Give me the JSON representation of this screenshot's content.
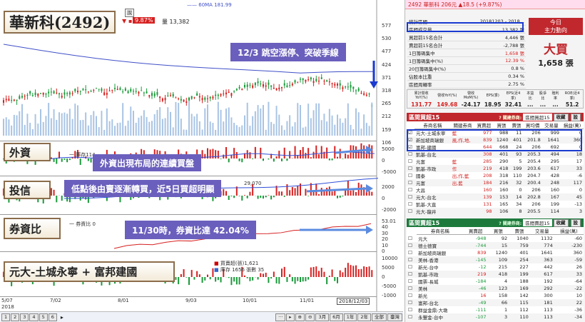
{
  "chart": {
    "legend_ma": "60MA 181.99",
    "mini_btn": "說",
    "price_badge": "9.87%",
    "volume_label": "量 13,382",
    "y_price": [
      "577",
      "530",
      "477",
      "424",
      "371",
      "318",
      "265",
      "212",
      "159",
      "106"
    ],
    "y_foreign": [
      "5000",
      "0",
      "-5000"
    ],
    "y_trust": [
      "2000",
      "0",
      "-2000"
    ],
    "y_margin": [
      "53.01",
      "40",
      "30",
      "20",
      "10",
      "0"
    ],
    "y_broker": [
      "10000",
      "5000",
      "0",
      "-5000",
      "-1000"
    ],
    "x_dates": [
      "5/07",
      "7/02",
      "8/01",
      "9/03",
      "10/01",
      "11/01"
    ],
    "x_first_year": "2018",
    "date_box": "2018/12/03",
    "foreign_sub": "一 庫存114",
    "trust_sub": "29,070",
    "margin_sub": "一 券資比 0",
    "broker_buy": "買賣超(張)1,621",
    "broker_stock": "庫存 1656 張數 35",
    "pages": [
      "1",
      "2",
      "3",
      "4",
      "5",
      "6"
    ],
    "zoom_buttons": [
      "3月",
      "6月",
      "1年",
      "2年",
      "全部",
      "臺灣"
    ]
  },
  "banners": {
    "stock": "華新科(2492)",
    "foreign": "外資",
    "trust": "投信",
    "margin": "券資比",
    "broker": "元大-土城永寧 + 富邦建國"
  },
  "annotations": {
    "a1": "12/3 跳空漲停、突破季線",
    "a2": "外資出現布局的連續買盤",
    "a3": "低點後由賣逐漸轉買，近5日買超明顯",
    "a4": "11/30時，券資比達 42.04%"
  },
  "panel": {
    "ticker": "2492 華新科 206元 ▲18.5 (+9.87%)",
    "stats": [
      {
        "k": "統計區間",
        "v": "20181203 - 2018..."
      },
      {
        "k": "區間成交量",
        "v": "13,382 張"
      },
      {
        "k": "買超前15名合計",
        "v": "4,446 張"
      },
      {
        "k": "賣超前15名合計",
        "v": "-2,788 張"
      },
      {
        "k": "1日籌碼集中",
        "v": "1,658 張"
      },
      {
        "k": "1日籌碼集中(%)",
        "v": "12.39 %"
      },
      {
        "k": "20日籌碼集中(%)",
        "v": "0.8 %"
      },
      {
        "k": "佔股本比重",
        "v": "0.34 %"
      },
      {
        "k": "區間周轉率",
        "v": "2.75 %"
      }
    ],
    "today_title": "今日",
    "today_sub": "主力動向",
    "today_verdict": "大買",
    "today_qty": "1,658 張",
    "fin_heads": [
      "累計營收YoY(%)",
      "營收YoY(%)",
      "營收MoM(%)",
      "EPS(季)",
      "EPS(近4季)",
      "本益比",
      "股淨比",
      "殖利率",
      "ROE(近4季)"
    ],
    "fin_vals": [
      "131.77",
      "149.68",
      "-24.17",
      "18.95",
      "32.41",
      "...",
      "...",
      "...",
      "51.2"
    ],
    "buy_title": "區間買超15",
    "buy_select": "區間買超15",
    "buy_heads": [
      "券商名稱",
      "關建券商",
      "買賣超",
      "買張",
      "賣張",
      "買均價",
      "交易量",
      "損益(萬)"
    ],
    "buy_rows": [
      [
        "元大-土城永寧",
        "藍",
        "977",
        "988",
        "11",
        "206",
        "999",
        "0"
      ],
      [
        "新加坡商瑞銀",
        "風,作,地,",
        "839",
        "1240",
        "401",
        "201.8",
        "1641",
        "360"
      ],
      [
        "富邦-建國",
        "",
        "644",
        "668",
        "24",
        "206",
        "692",
        "0"
      ],
      [
        "凱基-台北",
        "",
        "308",
        "401",
        "93",
        "205.3",
        "494",
        "18"
      ],
      [
        "元富",
        "藍",
        "285",
        "290",
        "5",
        "205.4",
        "295",
        "17"
      ],
      [
        "凱基-市政",
        "作",
        "219",
        "418",
        "199",
        "203.6",
        "617",
        "33"
      ],
      [
        "國泰",
        "出,作,藍",
        "208",
        "318",
        "110",
        "204.7",
        "428",
        "-6"
      ],
      [
        "元富",
        "出,藍",
        "184",
        "216",
        "32",
        "200.4",
        "248",
        "117"
      ],
      [
        "大昌",
        "",
        "160",
        "160",
        "0",
        "206",
        "160",
        "0"
      ],
      [
        "元大-台北",
        "",
        "139",
        "153",
        "14",
        "202.8",
        "167",
        "45"
      ],
      [
        "凱基-大直",
        "",
        "131",
        "165",
        "34",
        "206",
        "199",
        "-13"
      ],
      [
        "元大-龍井",
        "",
        "98",
        "106",
        "8",
        "205.5",
        "114",
        "3"
      ]
    ],
    "sell_title": "區間賣超15",
    "sell_select": "區間賣超15",
    "sell_heads": [
      "券商名稱",
      "買賣超",
      "買張",
      "賣張",
      "交易量",
      "損益(萬)"
    ],
    "sell_rows": [
      [
        "元大",
        "-948",
        "92",
        "1040",
        "1132",
        "-60"
      ],
      [
        "德士德寶",
        "-744",
        "15",
        "759",
        "774",
        "-230"
      ],
      [
        "新加坡商瑞銀",
        "839",
        "1240",
        "401",
        "1641",
        "360"
      ],
      [
        "美林-香港",
        "-145",
        "109",
        "254",
        "363",
        "-59"
      ],
      [
        "新光-台中",
        "-12",
        "215",
        "227",
        "442",
        "26"
      ],
      [
        "凱基-市政",
        "219",
        "418",
        "199",
        "617",
        "33"
      ],
      [
        "國票-長城",
        "-184",
        "4",
        "188",
        "192",
        "-64"
      ],
      [
        "美林",
        "-46",
        "123",
        "169",
        "292",
        "-22"
      ],
      [
        "新光",
        "16",
        "158",
        "142",
        "300",
        "10"
      ],
      [
        "富邦-台北",
        "-49",
        "66",
        "115",
        "181",
        "22"
      ],
      [
        "群益金鼎-大墩",
        "-111",
        "1",
        "112",
        "113",
        "-36"
      ],
      [
        "永豐金-台中",
        "-107",
        "3",
        "110",
        "113",
        "-34"
      ]
    ],
    "btn_fav": "收藏",
    "btn_set": "設"
  },
  "colors": {
    "up": "#d62020",
    "down": "#1a9a3a",
    "banner": "#6a5fbc",
    "header_red": "#c0282d",
    "header_green": "#1d7a3c"
  }
}
